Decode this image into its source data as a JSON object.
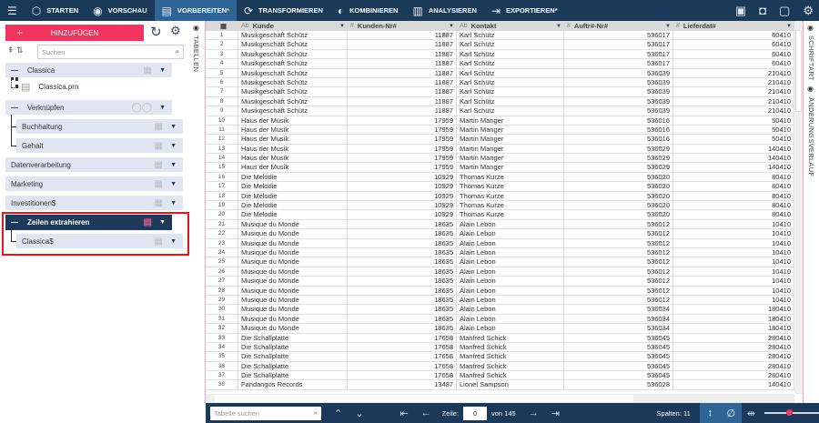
{
  "nav": {
    "tabs": [
      {
        "label": "STARTEN",
        "icon": "cube-icon"
      },
      {
        "label": "VORSCHAU",
        "icon": "eye-icon"
      },
      {
        "label": "VORBEREITEN*",
        "icon": "prepare-icon",
        "active": true
      },
      {
        "label": "TRANSFORMIEREN",
        "icon": "transform-icon"
      },
      {
        "label": "KOMBINIEREN",
        "icon": "combine-icon"
      },
      {
        "label": "ANALYSIEREN",
        "icon": "analyze-icon"
      },
      {
        "label": "EXPORTIEREN*",
        "icon": "export-icon"
      }
    ]
  },
  "left": {
    "add_label": "HINZUFÜGEN",
    "search_placeholder": "Suchen",
    "side_tab": "TABELLEN",
    "nodes": {
      "classica": "Classica",
      "classica_file": "Classica.prn",
      "verknuepfen": "Verknüpfen",
      "buchhaltung": "Buchhaltung",
      "gehalt": "Gehalt",
      "datenverarbeitung": "Datenverarbeitung",
      "marketing": "Marketing",
      "investitionen": "Investitionen$",
      "zeilen": "Zeilen extrahieren",
      "classica_out": "Classica$"
    }
  },
  "right_panel": {
    "schriftart": "SCHRIFTART",
    "verlauf": "ÄNDERUNGSVERLAUF"
  },
  "table": {
    "columns": [
      {
        "label": "Kunde",
        "type": "Ab"
      },
      {
        "label": "Kunden-Nr#",
        "type": "#"
      },
      {
        "label": "Kontakt",
        "type": "Ab"
      },
      {
        "label": "Auftr#-Nr#",
        "type": "#"
      },
      {
        "label": "Lieferdat#",
        "type": "#"
      }
    ],
    "rows": [
      [
        "Musikgeschäft Schütz",
        "11887",
        "Karl Schütz",
        "536017",
        "60410"
      ],
      [
        "Musikgeschäft Schütz",
        "11887",
        "Karl Schütz",
        "536017",
        "60410"
      ],
      [
        "Musikgeschäft Schütz",
        "11887",
        "Karl Schütz",
        "536017",
        "60410"
      ],
      [
        "Musikgeschäft Schütz",
        "11887",
        "Karl Schütz",
        "536017",
        "60410"
      ],
      [
        "Musikgeschäft Schütz",
        "11887",
        "Karl Schütz",
        "536039",
        "210410"
      ],
      [
        "Musikgeschäft Schütz",
        "11887",
        "Karl Schütz",
        "536039",
        "210410"
      ],
      [
        "Musikgeschäft Schütz",
        "11887",
        "Karl Schütz",
        "536039",
        "210410"
      ],
      [
        "Musikgeschäft Schütz",
        "11887",
        "Karl Schütz",
        "536039",
        "210410"
      ],
      [
        "Musikgeschäft Schütz",
        "11887",
        "Karl Schütz",
        "536039",
        "210410"
      ],
      [
        "Haus der Musik",
        "17959",
        "Martin Manger",
        "536016",
        "50410"
      ],
      [
        "Haus der Musik",
        "17959",
        "Martin Manger",
        "536016",
        "50410"
      ],
      [
        "Haus der Musik",
        "17959",
        "Martin Manger",
        "536016",
        "50410"
      ],
      [
        "Haus der Musik",
        "17959",
        "Martin Manger",
        "536029",
        "140410"
      ],
      [
        "Haus der Musik",
        "17959",
        "Martin Manger",
        "536029",
        "140410"
      ],
      [
        "Haus der Musik",
        "17959",
        "Martin Manger",
        "536029",
        "140410"
      ],
      [
        "Die Melodie",
        "10929",
        "Thomas Kurze",
        "536020",
        "80410"
      ],
      [
        "Die Melodie",
        "10929",
        "Thomas Kurze",
        "536020",
        "80410"
      ],
      [
        "Die Melodie",
        "10929",
        "Thomas Kurze",
        "536020",
        "80410"
      ],
      [
        "Die Melodie",
        "10929",
        "Thomas Kurze",
        "536020",
        "80410"
      ],
      [
        "Die Melodie",
        "10929",
        "Thomas Kurze",
        "536020",
        "80410"
      ],
      [
        "Musique du Monde",
        "18635",
        "Alain Lebon",
        "536012",
        "10410"
      ],
      [
        "Musique du Monde",
        "18635",
        "Alain Lebon",
        "536012",
        "10410"
      ],
      [
        "Musique du Monde",
        "18635",
        "Alain Lebon",
        "536012",
        "10410"
      ],
      [
        "Musique du Monde",
        "18635",
        "Alain Lebon",
        "536012",
        "10410"
      ],
      [
        "Musique du Monde",
        "18635",
        "Alain Lebon",
        "536012",
        "10410"
      ],
      [
        "Musique du Monde",
        "18635",
        "Alain Lebon",
        "536012",
        "10410"
      ],
      [
        "Musique du Monde",
        "18635",
        "Alain Lebon",
        "536012",
        "10410"
      ],
      [
        "Musique du Monde",
        "18635",
        "Alain Lebon",
        "536012",
        "10410"
      ],
      [
        "Musique du Monde",
        "18635",
        "Alain Lebon",
        "536012",
        "10410"
      ],
      [
        "Musique du Monde",
        "18635",
        "Alain Lebon",
        "536034",
        "180410"
      ],
      [
        "Musique du Monde",
        "18635",
        "Alain Lebon",
        "536034",
        "180410"
      ],
      [
        "Musique du Monde",
        "18635",
        "Alain Lebon",
        "536034",
        "180410"
      ],
      [
        "Die Schallplatte",
        "17658",
        "Manfred Schick",
        "536045",
        "280410"
      ],
      [
        "Die Schallplatte",
        "17658",
        "Manfred Schick",
        "536045",
        "280410"
      ],
      [
        "Die Schallplatte",
        "17658",
        "Manfred Schick",
        "536045",
        "280410"
      ],
      [
        "Die Schallplatte",
        "17658",
        "Manfred Schick",
        "536045",
        "280410"
      ],
      [
        "Die Schallplatte",
        "17658",
        "Manfred Schick",
        "536045",
        "280410"
      ],
      [
        "Fandangos Records",
        "13487",
        "Lionel Sampson",
        "536028",
        "140410"
      ]
    ]
  },
  "bottom": {
    "search_placeholder": "Tabelle suchen",
    "row_label": "Zeile:",
    "row_value": "0",
    "of_label": "von 145",
    "columns_label": "Spalten: 11",
    "zoom_fraction": 0.45
  }
}
